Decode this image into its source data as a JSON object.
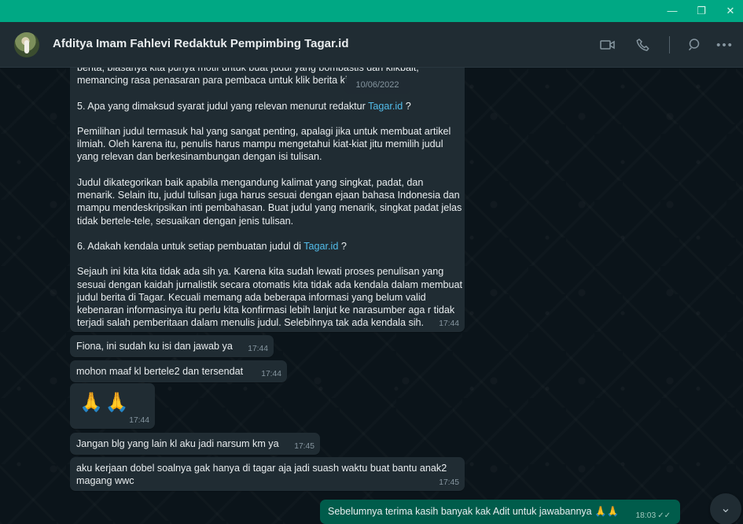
{
  "window": {
    "controls": {
      "minimize": "—",
      "maximize": "❐",
      "close": "✕"
    }
  },
  "header": {
    "contact_name": "Afditya Imam Fahlevi Redaktuk Pempimbing Tagar.id",
    "icons": [
      "video-call-icon",
      "phone-icon",
      "search-icon",
      "more-options-icon"
    ]
  },
  "colors": {
    "titlebar": "#00a884",
    "header": "#202c33",
    "chat_background": "#0b141a",
    "incoming_bubble": "#202c33",
    "outgoing_bubble": "#005c4b",
    "link": "#53bdeb"
  },
  "date_chip": "10/06/2022",
  "messages": {
    "long_message": {
      "lines": [
        "berita, biasanya kita punya motif untuk buat judul yang bombastis dan klikbait,",
        "memancing rasa penasaran para pembaca untuk klik berita ki",
        "",
        "5. Apa yang dimaksud syarat judul yang relevan menurut redaktur ",
        "",
        "Pemilihan judul termasuk hal yang sangat penting, apalagi jika untuk membuat artikel",
        "ilmiah. Oleh karena itu, penulis harus mampu mengetahui kiat-kiat jitu memilih judul",
        "yang relevan dan berkesinambungan dengan isi tulisan.",
        "",
        "Judul dikategorikan baik apabila mengandung kalimat yang singkat, padat, dan",
        "menarik. Selain itu, judul tulisan juga harus sesuai dengan ejaan bahasa Indonesia dan",
        "mampu mendeskripsikan inti pembahasan. Buat judul yang menarik, singkat padat jelas",
        "tidak bertele-tele, sesuaikan dengan jenis tulisan.",
        "",
        "6. Adakah kendala untuk setiap pembuatan judul di ",
        "",
        "Sejauh ini kita kita tidak ada sih ya. Karena kita sudah lewati proses penulisan yang",
        "sesuai dengan kaidah jurnalistik secara otomatis kita tidak ada kendala dalam membuat",
        "judul berita di Tagar. Kecuali memang ada beberapa informasi yang belum valid",
        "kebenaran informasinya itu perlu kita konfirmasi lebih lanjut ke narasumber aga r tidak",
        "terjadi salah pemberitaan dalam menulis judul. Selebihnya tak ada kendala sih."
      ],
      "link_text": "Tagar.id",
      "question_5_suffix": " ?",
      "question_6_suffix": " ?",
      "time": "17:44"
    },
    "message_2": {
      "text": "Fiona, ini sudah ku isi dan jawab ya",
      "time": "17:44"
    },
    "message_3": {
      "text": "mohon maaf kl bertele2 dan tersendat",
      "time": "17:44"
    },
    "message_4": {
      "emoji": "🙏🙏",
      "time": "17:44"
    },
    "message_5": {
      "text": "Jangan blg yang lain kl aku jadi narsum km ya",
      "time": "17:45"
    },
    "message_6": {
      "lines": [
        "aku kerjaan dobel soalnya gak hanya di tagar aja jadi suash waktu buat bantu anak2",
        "magang wwc"
      ],
      "time": "17:45"
    },
    "outgoing_message": {
      "text": "Sebelumnya terima kasih banyak kak Adit untuk jawabannya 🙏🙏",
      "time": "18:03",
      "ticks": "✓✓"
    }
  },
  "scroll_button": "⌄"
}
